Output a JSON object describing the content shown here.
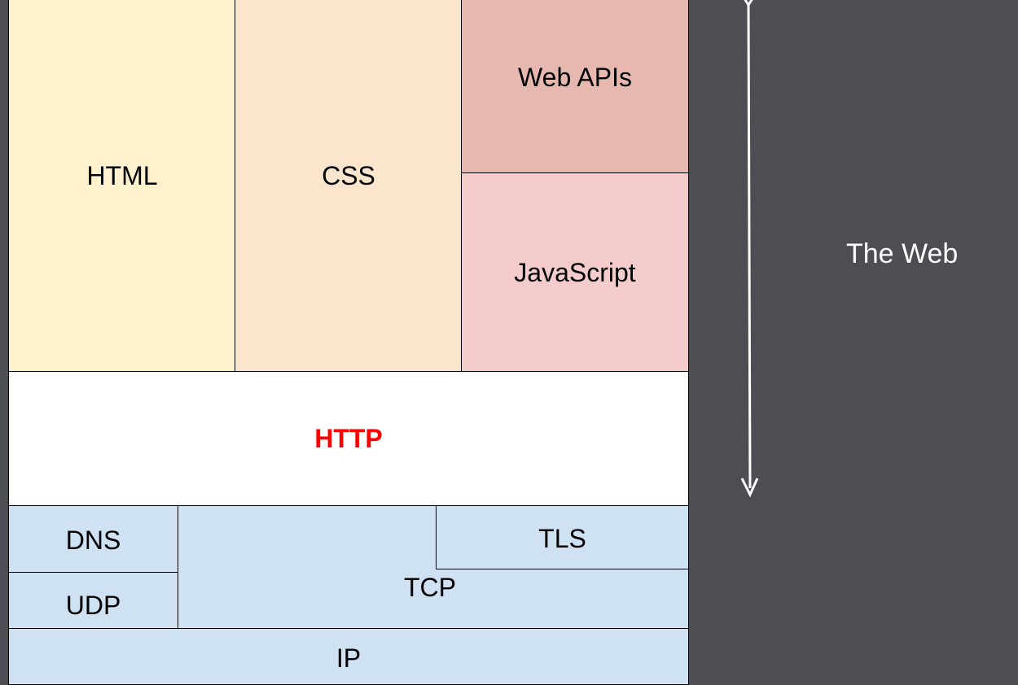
{
  "diagram": {
    "blocks": {
      "html": {
        "label": "HTML",
        "color": "#fff2cc"
      },
      "css": {
        "label": "CSS",
        "color": "#fce5cd"
      },
      "web_apis": {
        "label": "Web APIs",
        "color": "#e6b8af"
      },
      "javascript": {
        "label": "JavaScript",
        "color": "#f4cccc"
      },
      "http": {
        "label": "HTTP",
        "color": "#ffffff",
        "text_color": "#ff0000"
      },
      "dns": {
        "label": "DNS",
        "color": "#cfe2f3"
      },
      "udp": {
        "label": "UDP",
        "color": "#cfe2f3"
      },
      "tcp": {
        "label": "TCP",
        "color": "#cfe2f3"
      },
      "tls": {
        "label": "TLS",
        "color": "#cfe2f3"
      },
      "ip": {
        "label": "IP",
        "color": "#cfe2f3"
      }
    },
    "side_label": "The Web",
    "background_color": "#4d4e53",
    "arrow": "double-headed vertical arrow spanning the web layers"
  }
}
